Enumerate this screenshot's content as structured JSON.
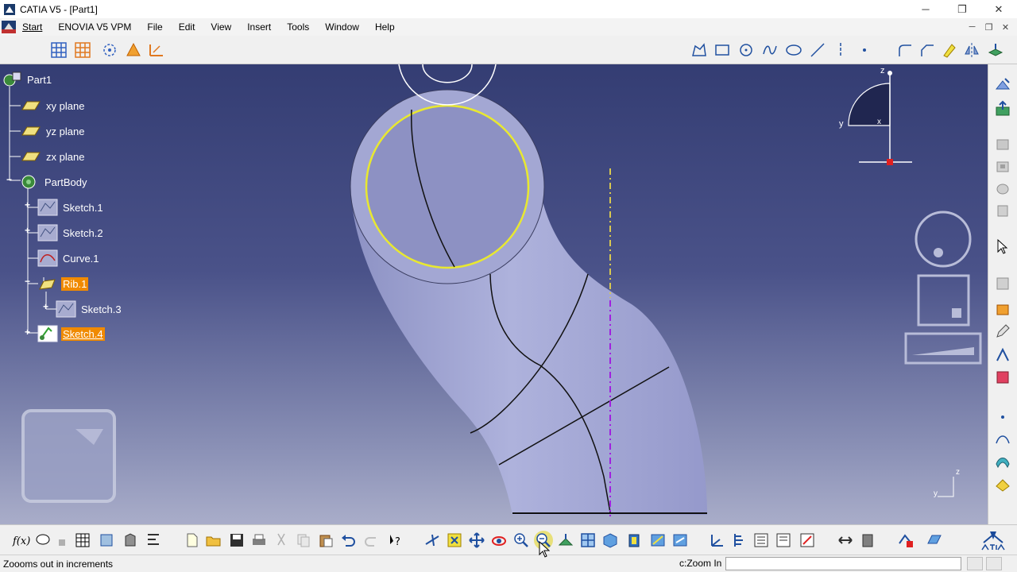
{
  "window": {
    "title": "CATIA V5 - [Part1]",
    "minimize_glyph": "─",
    "restore_glyph": "❐",
    "close_glyph": "✕"
  },
  "menubar": {
    "items": [
      "Start",
      "ENOVIA V5 VPM",
      "File",
      "Edit",
      "View",
      "Insert",
      "Tools",
      "Window",
      "Help"
    ],
    "mdi_glyphs": [
      "─",
      "❐",
      "✕"
    ]
  },
  "tree": {
    "root": "Part1",
    "planes": [
      "xy plane",
      "yz plane",
      "zx plane"
    ],
    "body": "PartBody",
    "features": [
      {
        "label": "Sketch.1",
        "expand": "+"
      },
      {
        "label": "Sketch.2",
        "expand": "+"
      },
      {
        "label": "Curve.1",
        "expand": ""
      },
      {
        "label": "Rib.1",
        "expand": "−"
      },
      {
        "label": "Sketch.3",
        "expand": "+"
      },
      {
        "label": "Sketch.4",
        "expand": "+"
      }
    ]
  },
  "compass": {
    "z_label": "z",
    "y_label": "y",
    "x_label": "x"
  },
  "axis_triad": {
    "z_label": "z",
    "y_label": "y"
  },
  "statusbar": {
    "message": "Zoooms out in increments",
    "command_label": "c:Zoom In",
    "command_value": ""
  },
  "icons": {
    "colors": {
      "accent_orange": "#f08a00",
      "viewport_top": "#343d73",
      "viewport_bottom": "#a9adc9",
      "pipe_face": "#a0a5cf",
      "selection_yellow": "#e8e830"
    }
  }
}
